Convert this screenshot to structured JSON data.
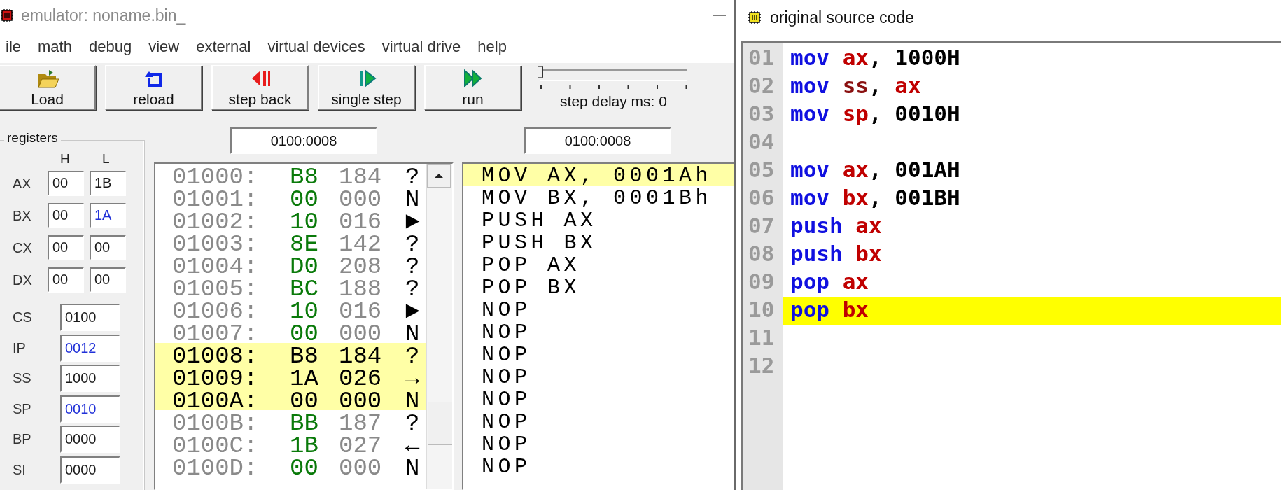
{
  "emulator": {
    "title": "emulator: noname.bin_",
    "menu": [
      "ile",
      "math",
      "debug",
      "view",
      "external",
      "virtual devices",
      "virtual drive",
      "help"
    ],
    "toolbar": [
      {
        "label": "Load",
        "kind": "load"
      },
      {
        "label": "reload",
        "kind": "reload"
      },
      {
        "label": "step back",
        "kind": "back"
      },
      {
        "label": "single step",
        "kind": "step"
      },
      {
        "label": "run",
        "kind": "run"
      }
    ],
    "step_delay": {
      "label": "step delay ms: 0",
      "level": 0
    },
    "registers": {
      "title": "registers",
      "columns": [
        "H",
        "L"
      ],
      "items": [
        {
          "name": "AX",
          "kind": "split",
          "h": {
            "value": "00",
            "changed": false
          },
          "l": {
            "value": "1B",
            "changed": false
          }
        },
        {
          "name": "BX",
          "kind": "split",
          "h": {
            "value": "00",
            "changed": false
          },
          "l": {
            "value": "1A",
            "changed": true
          }
        },
        {
          "name": "CX",
          "kind": "split",
          "h": {
            "value": "00",
            "changed": false
          },
          "l": {
            "value": "00",
            "changed": false
          }
        },
        {
          "name": "DX",
          "kind": "split",
          "h": {
            "value": "00",
            "changed": false
          },
          "l": {
            "value": "00",
            "changed": false
          }
        },
        {
          "name": "CS",
          "kind": "word",
          "value": "0100",
          "changed": false
        },
        {
          "name": "IP",
          "kind": "word",
          "value": "0012",
          "changed": true
        },
        {
          "name": "SS",
          "kind": "word",
          "value": "1000",
          "changed": false
        },
        {
          "name": "SP",
          "kind": "word",
          "value": "0010",
          "changed": true
        },
        {
          "name": "BP",
          "kind": "word",
          "value": "0000",
          "changed": false
        },
        {
          "name": "SI",
          "kind": "word",
          "value": "0000",
          "changed": false
        }
      ]
    },
    "memory": {
      "address": "0100:0008",
      "rows": [
        {
          "address": "01000:",
          "hex": "B8",
          "dec": "184",
          "char": "?",
          "selected": false
        },
        {
          "address": "01001:",
          "hex": "00",
          "dec": "000",
          "char": "N",
          "selected": false
        },
        {
          "address": "01002:",
          "hex": "10",
          "dec": "016",
          "char": "►",
          "selected": false
        },
        {
          "address": "01003:",
          "hex": "8E",
          "dec": "142",
          "char": "?",
          "selected": false
        },
        {
          "address": "01004:",
          "hex": "D0",
          "dec": "208",
          "char": "?",
          "selected": false
        },
        {
          "address": "01005:",
          "hex": "BC",
          "dec": "188",
          "char": "?",
          "selected": false
        },
        {
          "address": "01006:",
          "hex": "10",
          "dec": "016",
          "char": "►",
          "selected": false
        },
        {
          "address": "01007:",
          "hex": "00",
          "dec": "000",
          "char": "N",
          "selected": false
        },
        {
          "address": "01008:",
          "hex": "B8",
          "dec": "184",
          "char": "?",
          "selected": true
        },
        {
          "address": "01009:",
          "hex": "1A",
          "dec": "026",
          "char": "→",
          "selected": true
        },
        {
          "address": "0100A:",
          "hex": "00",
          "dec": "000",
          "char": "N",
          "selected": true
        },
        {
          "address": "0100B:",
          "hex": "BB",
          "dec": "187",
          "char": "?",
          "selected": false
        },
        {
          "address": "0100C:",
          "hex": "1B",
          "dec": "027",
          "char": "←",
          "selected": false
        },
        {
          "address": "0100D:",
          "hex": "00",
          "dec": "000",
          "char": "N",
          "selected": false
        }
      ]
    },
    "disassembly": {
      "address": "0100:0008",
      "rows": [
        {
          "text": "MOV AX, 0001Ah",
          "selected": true
        },
        {
          "text": "MOV BX, 0001Bh",
          "selected": false
        },
        {
          "text": "PUSH AX",
          "selected": false
        },
        {
          "text": "PUSH BX",
          "selected": false
        },
        {
          "text": "POP AX",
          "selected": false
        },
        {
          "text": "POP BX",
          "selected": false
        },
        {
          "text": "NOP",
          "selected": false
        },
        {
          "text": "NOP",
          "selected": false
        },
        {
          "text": "NOP",
          "selected": false
        },
        {
          "text": "NOP",
          "selected": false
        },
        {
          "text": "NOP",
          "selected": false
        },
        {
          "text": "NOP",
          "selected": false
        },
        {
          "text": "NOP",
          "selected": false
        },
        {
          "text": "NOP",
          "selected": false
        }
      ]
    }
  },
  "source": {
    "title": "original source code",
    "lines": [
      {
        "number": "01",
        "selected": false,
        "tokens": [
          {
            "text": "mov",
            "kind": "instruction"
          },
          {
            "text": "ax",
            "kind": "register"
          },
          {
            "text": ",",
            "kind": "punct"
          },
          {
            "text": "1000H",
            "kind": "number"
          }
        ]
      },
      {
        "number": "02",
        "selected": false,
        "tokens": [
          {
            "text": "mov",
            "kind": "instruction"
          },
          {
            "text": "ss",
            "kind": "segment"
          },
          {
            "text": ",",
            "kind": "punct"
          },
          {
            "text": "ax",
            "kind": "register"
          }
        ]
      },
      {
        "number": "03",
        "selected": false,
        "tokens": [
          {
            "text": "mov",
            "kind": "instruction"
          },
          {
            "text": "sp",
            "kind": "register"
          },
          {
            "text": ",",
            "kind": "punct"
          },
          {
            "text": "0010H",
            "kind": "number"
          }
        ]
      },
      {
        "number": "04",
        "selected": false
      },
      {
        "number": "05",
        "selected": false,
        "tokens": [
          {
            "text": "mov",
            "kind": "instruction"
          },
          {
            "text": "ax",
            "kind": "register"
          },
          {
            "text": ",",
            "kind": "punct"
          },
          {
            "text": "001AH",
            "kind": "number"
          }
        ]
      },
      {
        "number": "06",
        "selected": false,
        "tokens": [
          {
            "text": "mov",
            "kind": "instruction"
          },
          {
            "text": "bx",
            "kind": "register"
          },
          {
            "text": ",",
            "kind": "punct"
          },
          {
            "text": "001BH",
            "kind": "number"
          }
        ]
      },
      {
        "number": "07",
        "selected": false,
        "tokens": [
          {
            "text": "push",
            "kind": "instruction"
          },
          {
            "text": "ax",
            "kind": "register"
          }
        ]
      },
      {
        "number": "08",
        "selected": false,
        "tokens": [
          {
            "text": "push",
            "kind": "instruction"
          },
          {
            "text": "bx",
            "kind": "register"
          }
        ]
      },
      {
        "number": "09",
        "selected": false,
        "tokens": [
          {
            "text": "pop",
            "kind": "instruction"
          },
          {
            "text": "ax",
            "kind": "register"
          }
        ]
      },
      {
        "number": "10",
        "selected": true,
        "tokens": [
          {
            "text": "pop",
            "kind": "instruction"
          },
          {
            "text": "bx",
            "kind": "register"
          }
        ]
      },
      {
        "number": "11",
        "selected": false
      },
      {
        "number": "12",
        "selected": false
      }
    ]
  }
}
